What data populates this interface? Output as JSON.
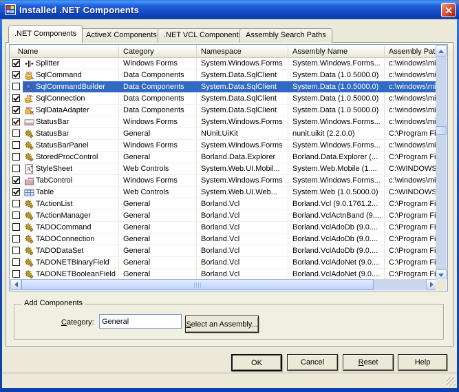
{
  "window": {
    "title": "Installed .NET Components"
  },
  "colors": {
    "selection": "#316AC5",
    "titlebar_blue": "#1550C8",
    "dialog_face": "#ECE9D8"
  },
  "tabs": [
    ".NET Components",
    "ActiveX Components",
    ".NET VCL Components",
    "Assembly Search Paths"
  ],
  "active_tab": ".NET Components",
  "table": {
    "columns": [
      "Name",
      "Category",
      "Namespace",
      "Assembly Name",
      "Assembly Path"
    ],
    "selected_index": 2,
    "rows": [
      {
        "checked": true,
        "icon": "splitter",
        "name": "Splitter",
        "category": "Windows Forms",
        "namespace": "System.Windows.Forms",
        "assembly": "System.Windows.Forms...",
        "path": "c:\\windows\\mic"
      },
      {
        "checked": true,
        "icon": "sql-command",
        "name": "SqlCommand",
        "category": "Data Components",
        "namespace": "System.Data.SqlClient",
        "assembly": "System.Data (1.0.5000.0)",
        "path": "c:\\windows\\mic"
      },
      {
        "checked": false,
        "icon": "gear-blue",
        "name": "SqlCommandBuilder",
        "category": "Data Components",
        "namespace": "System.Data.SqlClient",
        "assembly": "System.Data (1.0.5000.0)",
        "path": "c:\\windows\\mic"
      },
      {
        "checked": true,
        "icon": "sql-connection",
        "name": "SqlConnection",
        "category": "Data Components",
        "namespace": "System.Data.SqlClient",
        "assembly": "System.Data (1.0.5000.0)",
        "path": "c:\\windows\\mic"
      },
      {
        "checked": true,
        "icon": "sql-adapter",
        "name": "SqlDataAdapter",
        "category": "Data Components",
        "namespace": "System.Data.SqlClient",
        "assembly": "System.Data (1.0.5000.0)",
        "path": "c:\\windows\\mic"
      },
      {
        "checked": true,
        "icon": "statusbar",
        "name": "StatusBar",
        "category": "Windows Forms",
        "namespace": "System.Windows.Forms",
        "assembly": "System.Windows.Forms...",
        "path": "c:\\windows\\mic"
      },
      {
        "checked": false,
        "icon": "gear",
        "name": "StatusBar",
        "category": "General",
        "namespace": "NUnit.UiKit",
        "assembly": "nunit.uikit (2.2.0.0)",
        "path": "C:\\Program File"
      },
      {
        "checked": false,
        "icon": "gear",
        "name": "StatusBarPanel",
        "category": "Windows Forms",
        "namespace": "System.Windows.Forms",
        "assembly": "System.Windows.Forms...",
        "path": "c:\\windows\\mic"
      },
      {
        "checked": false,
        "icon": "gear",
        "name": "StoredProcControl",
        "category": "General",
        "namespace": "Borland.Data.Explorer",
        "assembly": "Borland.Data.Explorer (...",
        "path": "C:\\Program File"
      },
      {
        "checked": false,
        "icon": "stylesheet",
        "name": "StyleSheet",
        "category": "Web Controls",
        "namespace": "System.Web.UI.Mobil...",
        "assembly": "System.Web.Mobile (1....",
        "path": "C:\\WINDOWS\\M"
      },
      {
        "checked": true,
        "icon": "tab-control",
        "name": "TabControl",
        "category": "Windows Forms",
        "namespace": "System.Windows.Forms",
        "assembly": "System.Windows.Forms...",
        "path": "c:\\windows\\mic"
      },
      {
        "checked": true,
        "icon": "table",
        "name": "Table",
        "category": "Web Controls",
        "namespace": "System.Web.UI.Web...",
        "assembly": "System.Web (1.0.5000.0)",
        "path": "C:\\WINDOWS\\M"
      },
      {
        "checked": false,
        "icon": "gear",
        "name": "TActionList",
        "category": "General",
        "namespace": "Borland.Vcl",
        "assembly": "Borland.Vcl (9.0.1761.2...",
        "path": "C:\\Program File"
      },
      {
        "checked": false,
        "icon": "gear",
        "name": "TActionManager",
        "category": "General",
        "namespace": "Borland.Vcl",
        "assembly": "Borland.VclActnBand (9....",
        "path": "C:\\Program File"
      },
      {
        "checked": false,
        "icon": "gear",
        "name": "TADOCommand",
        "category": "General",
        "namespace": "Borland.Vcl",
        "assembly": "Borland.VclAdoDb (9.0....",
        "path": "C:\\Program File"
      },
      {
        "checked": false,
        "icon": "gear",
        "name": "TADOConnection",
        "category": "General",
        "namespace": "Borland.Vcl",
        "assembly": "Borland.VclAdoDb (9.0....",
        "path": "C:\\Program File"
      },
      {
        "checked": false,
        "icon": "gear",
        "name": "TADODataSet",
        "category": "General",
        "namespace": "Borland.Vcl",
        "assembly": "Borland.VclAdoDb (9.0....",
        "path": "C:\\Program File"
      },
      {
        "checked": false,
        "icon": "gear",
        "name": "TADONETBinaryField",
        "category": "General",
        "namespace": "Borland.Vcl",
        "assembly": "Borland.VclAdoNet (9.0....",
        "path": "C:\\Program File"
      },
      {
        "checked": false,
        "icon": "gear",
        "name": "TADONETBooleanField",
        "category": "General",
        "namespace": "Borland.Vcl",
        "assembly": "Borland.VclAdoNet (9.0....",
        "path": "C:\\Program File"
      }
    ]
  },
  "add_components": {
    "legend": "Add Components",
    "category_label": "Category:",
    "category_value": "General",
    "select_assembly_label": "Select an Assembly..."
  },
  "buttons": {
    "ok": "OK",
    "cancel": "Cancel",
    "reset": "Reset",
    "help": "Help"
  }
}
